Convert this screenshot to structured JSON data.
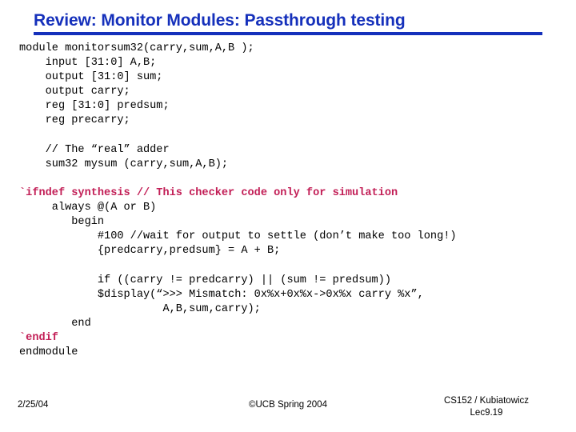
{
  "slide": {
    "title": "Review: Monitor Modules: Passthrough testing",
    "accent_color": "#1530bb",
    "highlight_color": "#c21e56"
  },
  "code": {
    "language": "verilog",
    "lines": [
      {
        "text": "module monitorsum32(carry,sum,A,B );",
        "highlight": false
      },
      {
        "text": "    input [31:0] A,B;",
        "highlight": false
      },
      {
        "text": "    output [31:0] sum;",
        "highlight": false
      },
      {
        "text": "    output carry;",
        "highlight": false
      },
      {
        "text": "    reg [31:0] predsum;",
        "highlight": false
      },
      {
        "text": "    reg precarry;",
        "highlight": false
      },
      {
        "text": "",
        "highlight": false
      },
      {
        "text": "    // The “real” adder",
        "highlight": false
      },
      {
        "text": "    sum32 mysum (carry,sum,A,B);",
        "highlight": false
      },
      {
        "text": "",
        "highlight": false
      },
      {
        "text": "`ifndef synthesis // This checker code only for simulation",
        "highlight": true
      },
      {
        "text": "     always @(A or B)",
        "highlight": false
      },
      {
        "text": "        begin",
        "highlight": false
      },
      {
        "text": "            #100 //wait for output to settle (don’t make too long!)",
        "highlight": false
      },
      {
        "text": "            {predcarry,predsum} = A + B;",
        "highlight": false
      },
      {
        "text": "",
        "highlight": false
      },
      {
        "text": "            if ((carry != predcarry) || (sum != predsum))",
        "highlight": false
      },
      {
        "text": "            $display(“>>> Mismatch: 0x%x+0x%x->0x%x carry %x”,",
        "highlight": false
      },
      {
        "text": "                      A,B,sum,carry);",
        "highlight": false
      },
      {
        "text": "        end",
        "highlight": false
      },
      {
        "text": "`endif",
        "highlight": true
      },
      {
        "text": "endmodule",
        "highlight": false
      }
    ]
  },
  "footer": {
    "date": "2/25/04",
    "center": "©UCB Spring 2004",
    "course": "CS152 / Kubiatowicz",
    "lecture": "Lec9.19"
  }
}
